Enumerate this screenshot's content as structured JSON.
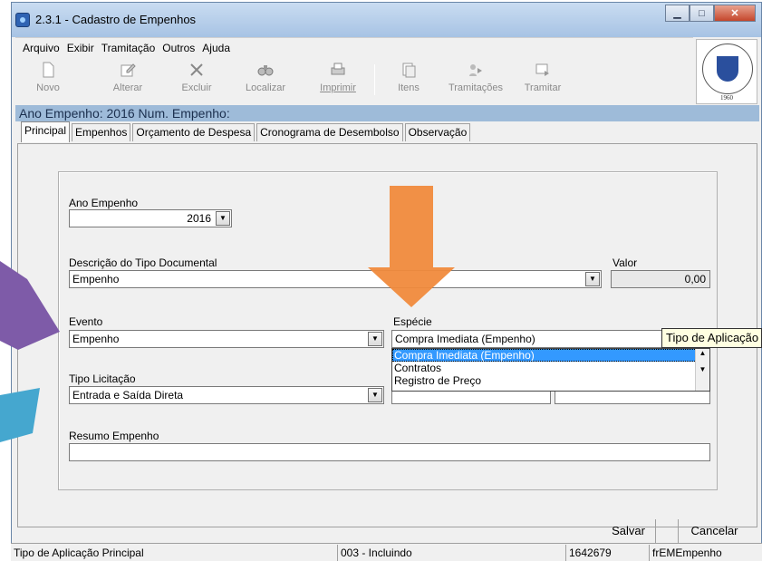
{
  "window": {
    "title": "2.3.1 - Cadastro de Empenhos"
  },
  "menu": [
    "Arquivo",
    "Exibir",
    "Tramitação",
    "Outros",
    "Ajuda"
  ],
  "toolbar": {
    "novo": "Novo",
    "alterar": "Alterar",
    "excluir": "Excluir",
    "localizar": "Localizar",
    "imprimir": "Imprimir",
    "itens": "Itens",
    "tramitacoes": "Tramitações",
    "tramitar": "Tramitar"
  },
  "logo": {
    "year": "1960",
    "text": "Universidade Federal de Santa Maria"
  },
  "infobar": "Ano Empenho: 2016  Num. Empenho:",
  "tabs": [
    "Principal",
    "Empenhos",
    "Orçamento de Despesa",
    "Cronograma de Desembolso",
    "Observação"
  ],
  "form": {
    "ano_label": "Ano Empenho",
    "ano_value": "2016",
    "descricao_label": "Descrição do Tipo Documental",
    "descricao_value": "Empenho",
    "valor_label": "Valor",
    "valor_value": "0,00",
    "evento_label": "Evento",
    "evento_value": "Empenho",
    "especie_label": "Espécie",
    "especie_value": "Compra Imediata (Empenho)",
    "tipo_licitacao_label": "Tipo Licitação",
    "tipo_licitacao_value": "Entrada e Saída Direta",
    "resumo_label": "Resumo Empenho",
    "resumo_value": ""
  },
  "especie_dropdown": [
    "Compra Imediata (Empenho)",
    "Contratos",
    "Registro de Preço"
  ],
  "tooltip": "Tipo de Aplicação",
  "buttons": {
    "salvar": "Salvar",
    "cancelar": "Cancelar"
  },
  "status": {
    "hint": "Tipo de Aplicação Principal",
    "mode": "003 - Incluindo",
    "code": "1642679",
    "form": "frEMEmpenho"
  },
  "colors": {
    "accent": "#9ebbd9",
    "arrow_orange": "#f08a3c",
    "arrow_purple": "#7e5ba8",
    "arrow_teal": "#45a7cf"
  }
}
